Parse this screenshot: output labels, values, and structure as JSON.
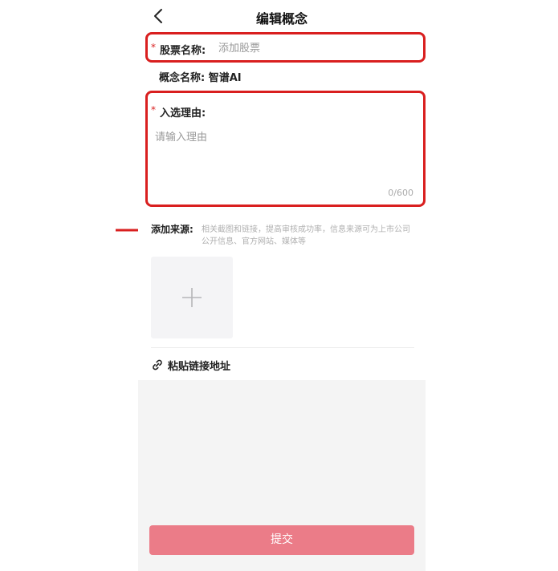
{
  "header": {
    "title": "编辑概念"
  },
  "stock": {
    "required_mark": "*",
    "label": "股票名称:",
    "placeholder": "添加股票"
  },
  "concept": {
    "label": "概念名称:",
    "value": "智谱AI"
  },
  "reason": {
    "required_mark": "*",
    "label": "入选理由:",
    "placeholder": "请输入理由",
    "char_count": "0/600"
  },
  "source": {
    "label": "添加来源:",
    "hint": "相关截图和链接，提高审核成功率，信息来源可为上市公司公开信息、官方网站、媒体等"
  },
  "paste_link": {
    "label": "粘贴链接地址"
  },
  "submit": {
    "label": "提交"
  },
  "colors": {
    "highlight_red": "#d91f1f",
    "submit_pink": "#eb7c88"
  },
  "icons": [
    "back-arrow-icon",
    "plus-icon",
    "link-icon",
    "annotation-arrow-icon"
  ]
}
